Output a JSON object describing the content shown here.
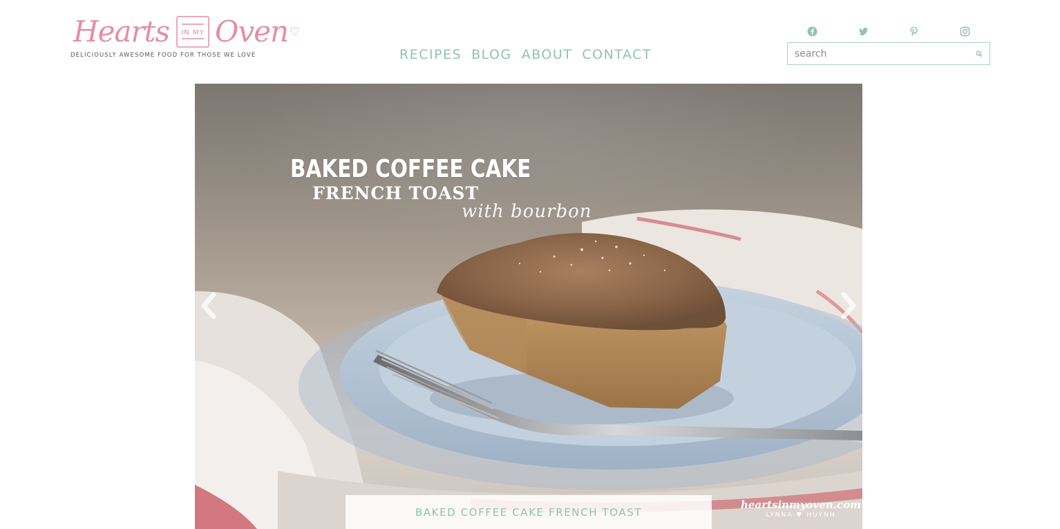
{
  "logo": {
    "word1": "Hearts",
    "mid": "IN MY",
    "word2": "Oven",
    "tagline": "DELICIOUSLY AWESOME FOOD FOR THOSE WE LOVE"
  },
  "nav": {
    "items": [
      {
        "label": "RECIPES"
      },
      {
        "label": "BLOG"
      },
      {
        "label": "ABOUT"
      },
      {
        "label": "CONTACT"
      }
    ]
  },
  "social": {
    "icons": [
      "facebook-icon",
      "twitter-icon",
      "pinterest-icon",
      "instagram-icon"
    ]
  },
  "search": {
    "placeholder": "search"
  },
  "slider": {
    "title_line1": "BAKED COFFEE CAKE",
    "title_line2": "FRENCH TOAST",
    "title_line3": "with bourbon",
    "caption": "BAKED COFFEE CAKE FRENCH TOAST",
    "watermark_line1": "heartsinmyoven.com",
    "watermark_line2": "LYNNA ♥ HUYNH",
    "prev_icon": "chevron-left-icon",
    "next_icon": "chevron-right-icon"
  },
  "colors": {
    "accent_teal": "#8dc3b4",
    "brand_pink": "#e58ea2",
    "search_border": "#a6d3c6"
  }
}
